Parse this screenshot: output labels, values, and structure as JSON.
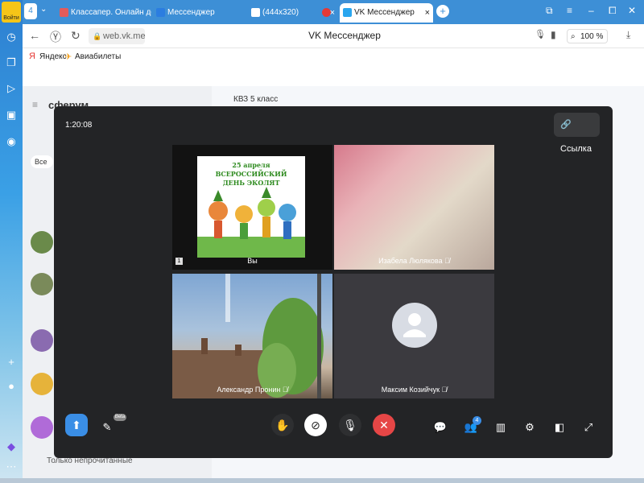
{
  "rail": {
    "logo_text": "Войти",
    "icons": [
      "clock-icon",
      "collection-icon",
      "play-icon",
      "app-icon",
      "camera-icon",
      "plus-icon",
      "alice-icon",
      "more-icon"
    ]
  },
  "tabs": {
    "profile_badge": "4",
    "items": [
      {
        "label": "Классапер. Онлайн доск",
        "icon_color": "#e25b5b"
      },
      {
        "label": "Мессенджер",
        "icon_color": "#2b7de0"
      },
      {
        "label": "(444x320)",
        "icon_color": "#ffffff"
      },
      {
        "label": "",
        "icon_color": "#e53935"
      },
      {
        "label": "VK Мессенджер",
        "icon_color": "#2aa6ef",
        "active": true
      }
    ],
    "new_tab": "+",
    "close_glyph": "×"
  },
  "addressbar": {
    "url": "web.vk.me",
    "page_title": "VK Мессенджер",
    "zoom": "100 %"
  },
  "bookmarks": [
    {
      "label": "Яндекс",
      "glyph": "Я"
    },
    {
      "label": "Авиабилеты",
      "glyph": "✈"
    }
  ],
  "messenger": {
    "brand": "сферум",
    "chat_title": "КВЗ 5 класс",
    "filter_all": "Все",
    "unread_filter": "Только непрочитанные"
  },
  "call": {
    "timer": "1:20:08",
    "link_button": "Ссылка",
    "poster": {
      "line1": "25 апреля",
      "line2": "ВСЕРОССИЙСКИЙ",
      "line3": "ДЕНЬ ЭКОЛЯТ"
    },
    "participants": [
      {
        "name": "Вы"
      },
      {
        "name": "Изабела Люлякова"
      },
      {
        "name": "Александр Пронин"
      },
      {
        "name": "Максим Козийчук"
      }
    ],
    "you_badge": "1",
    "beta_label": "Beta",
    "participants_count": "4",
    "colors": {
      "hangup": "#e64646",
      "video_off": "#ffffff",
      "share": "#3a8ee6"
    }
  }
}
